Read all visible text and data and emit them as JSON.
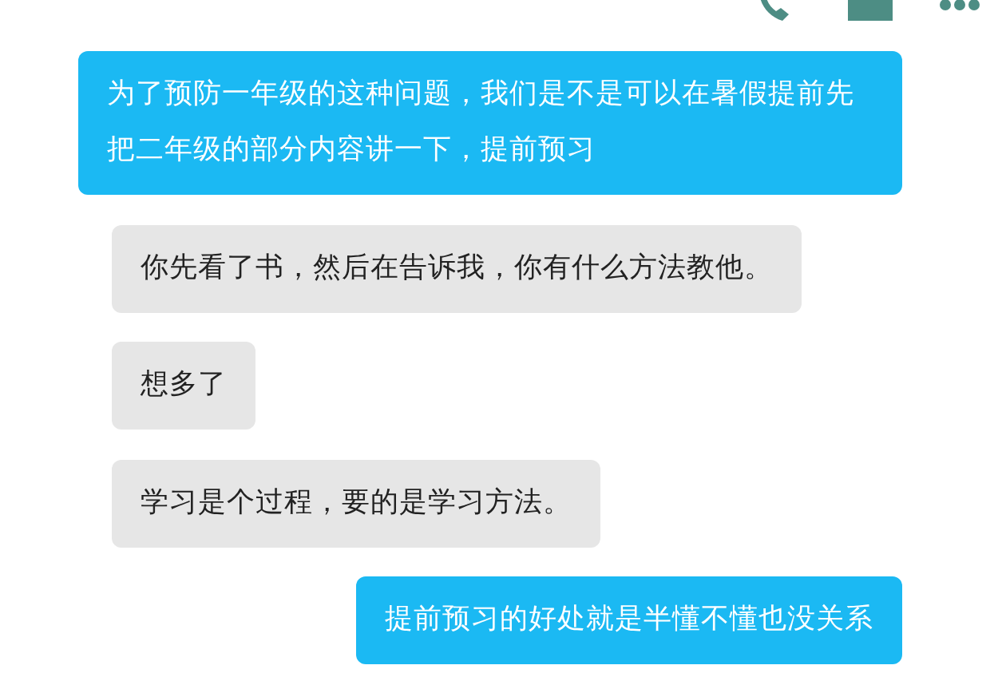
{
  "messages": [
    {
      "kind": "sent",
      "text": "为了预防一年级的这种问题，我们是不是可以在暑假提前先把二年级的部分内容讲一下，提前预习"
    },
    {
      "kind": "received",
      "text": "你先看了书，然后在告诉我，你有什么方法教他。"
    },
    {
      "kind": "received",
      "text": "想多了"
    },
    {
      "kind": "received",
      "text": "学习是个过程，要的是学习方法。"
    },
    {
      "kind": "sent",
      "text": "提前预习的好处就是半懂不懂也没关系"
    }
  ]
}
